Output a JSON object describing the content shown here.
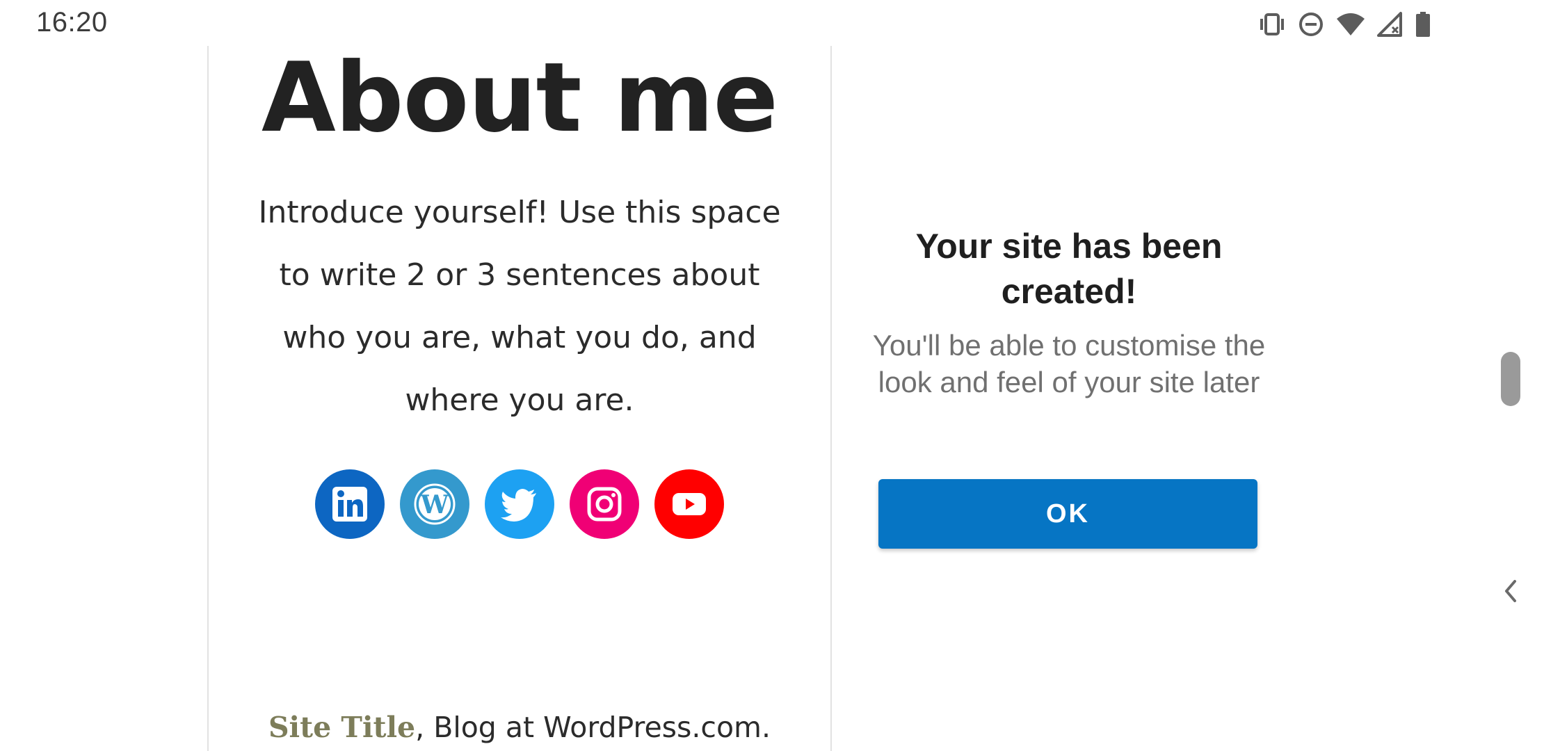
{
  "status_bar": {
    "time": "16:20",
    "icons": [
      "vibrate-icon",
      "do-not-disturb-icon",
      "wifi-icon",
      "cellular-no-signal-icon",
      "battery-icon"
    ]
  },
  "preview": {
    "heading": "About me",
    "intro": "Introduce yourself! Use this space to write 2 or 3 sentences about who you are, what you do, and where you are.",
    "social_links": [
      {
        "name": "linkedin-icon",
        "color": "#0d66c2"
      },
      {
        "name": "wordpress-icon",
        "color": "#3499cd"
      },
      {
        "name": "twitter-icon",
        "color": "#1da1f2"
      },
      {
        "name": "instagram-icon",
        "color": "#f00075"
      },
      {
        "name": "youtube-icon",
        "color": "#ff0000"
      }
    ],
    "footer": {
      "site_title": "Site Title",
      "separator": ", ",
      "credit": "Blog at WordPress.com."
    }
  },
  "dialog": {
    "title": "Your site has been created!",
    "subtitle": "You'll be able to customise the look and feel of your site later",
    "ok_label": "OK",
    "accent_color": "#0675c4"
  },
  "edge_controls": {
    "scrollbar": "scroll-handle",
    "back": "chevron-left-icon"
  }
}
